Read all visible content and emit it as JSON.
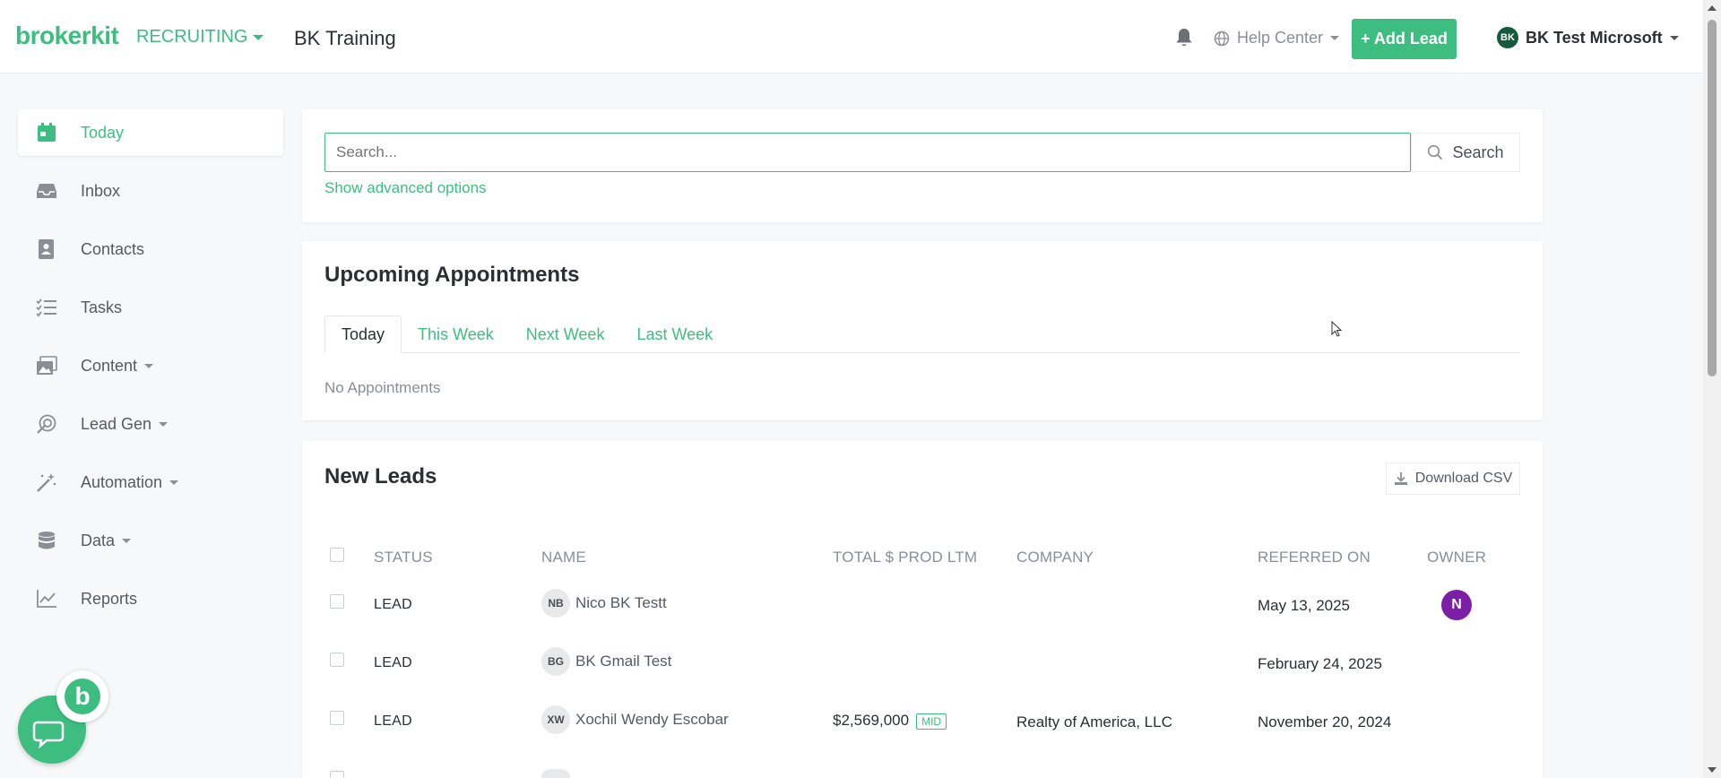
{
  "header": {
    "logo": "brokerkit",
    "product": "RECRUITING",
    "workspace": "BK Training",
    "help_label": "Help Center",
    "add_lead_label": "+ Add Lead",
    "user_initials": "BK",
    "user_name": "BK Test Microsoft"
  },
  "sidebar": {
    "items": [
      {
        "label": "Today",
        "icon": "calendar-icon",
        "active": true
      },
      {
        "label": "Inbox",
        "icon": "inbox-icon"
      },
      {
        "label": "Contacts",
        "icon": "contacts-icon"
      },
      {
        "label": "Tasks",
        "icon": "tasks-icon"
      },
      {
        "label": "Content",
        "icon": "content-icon",
        "dropdown": true
      },
      {
        "label": "Lead Gen",
        "icon": "lead-gen-icon",
        "dropdown": true
      },
      {
        "label": "Automation",
        "icon": "automation-icon",
        "dropdown": true
      },
      {
        "label": "Data",
        "icon": "database-icon",
        "dropdown": true
      },
      {
        "label": "Reports",
        "icon": "reports-icon"
      }
    ]
  },
  "chat_widget": {
    "letter": "b"
  },
  "search": {
    "placeholder": "Search...",
    "button_label": "Search",
    "advanced_label": "Show advanced options"
  },
  "appointments": {
    "title": "Upcoming Appointments",
    "tabs": [
      "Today",
      "This Week",
      "Next Week",
      "Last Week"
    ],
    "active_tab": "Today",
    "empty_text": "No Appointments"
  },
  "leads": {
    "title": "New Leads",
    "download_label": "Download CSV",
    "columns": [
      "STATUS",
      "NAME",
      "TOTAL $ PROD LTM",
      "COMPANY",
      "REFERRED ON",
      "OWNER"
    ],
    "rows": [
      {
        "status": "LEAD",
        "initials": "NB",
        "name": "Nico BK Testt",
        "prod": "",
        "tier": "",
        "company": "",
        "referred": "May 13, 2025",
        "owner": "N"
      },
      {
        "status": "LEAD",
        "initials": "BG",
        "name": "BK Gmail Test",
        "prod": "",
        "tier": "",
        "company": "",
        "referred": "February 24, 2025",
        "owner": ""
      },
      {
        "status": "LEAD",
        "initials": "XW",
        "name": "Xochil Wendy Escobar",
        "prod": "$2,569,000",
        "tier": "MID",
        "company": "Realty of America, LLC",
        "referred": "November 20, 2024",
        "owner": ""
      }
    ]
  },
  "colors": {
    "accent": "#3dbe80",
    "owner_purple": "#7a1fa6"
  }
}
